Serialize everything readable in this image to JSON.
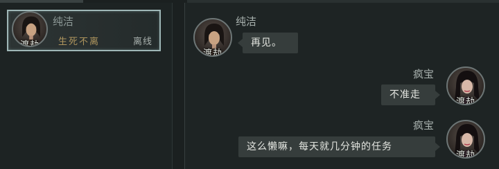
{
  "contact_list": {
    "contact": {
      "name": "纯洁",
      "avatar_tag": "渡劫",
      "motto": "生死不离",
      "status": "离线"
    }
  },
  "chat": {
    "messages": [
      {
        "sender": "纯洁",
        "avatar_tag": "渡劫",
        "text": "再见。",
        "side": "left"
      },
      {
        "sender": "疯宝",
        "avatar_tag": "渡劫",
        "text": "不准走",
        "side": "right"
      },
      {
        "sender": "疯宝",
        "avatar_tag": "渡劫",
        "text": "这么懒嘛，每天就几分钟的任务",
        "side": "right"
      }
    ]
  },
  "colors": {
    "background": "#1b2020",
    "bubble": "#363d3c",
    "card_border": "#9fb7b7",
    "motto": "#b0965e"
  },
  "icons": {
    "male_avatar": "male-character-portrait-icon",
    "female_avatar": "female-character-portrait-icon"
  }
}
